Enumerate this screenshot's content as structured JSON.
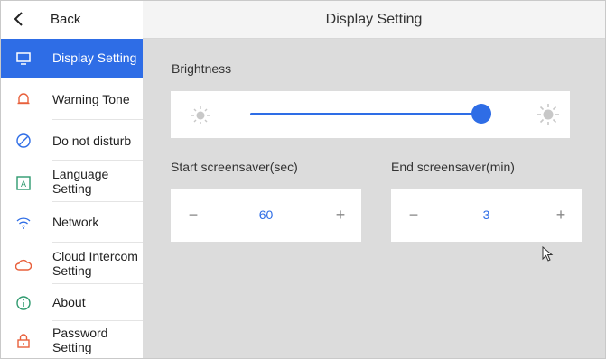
{
  "sidebar": {
    "back_label": "Back",
    "items": [
      {
        "label": "Display Setting",
        "icon": "monitor-icon",
        "active": true
      },
      {
        "label": "Warning Tone",
        "icon": "bell-icon"
      },
      {
        "label": "Do not disturb",
        "icon": "no-disturb-icon"
      },
      {
        "label_line1": "Language",
        "label_line2": "Setting",
        "icon": "language-icon"
      },
      {
        "label": "Network",
        "icon": "wifi-icon"
      },
      {
        "label_line1": "Cloud Intercom",
        "label_line2": "Setting",
        "icon": "cloud-icon"
      },
      {
        "label": "About",
        "icon": "info-icon"
      },
      {
        "label_line1": "Password",
        "label_line2": "Setting",
        "icon": "lock-icon"
      }
    ]
  },
  "header": {
    "title": "Display Setting"
  },
  "brightness": {
    "label": "Brightness",
    "level": 1.0
  },
  "screensaver_start": {
    "label": "Start screensaver(sec)",
    "minus": "−",
    "value": "60",
    "plus": "+"
  },
  "screensaver_end": {
    "label": "End screensaver(min)",
    "minus": "−",
    "value": "3",
    "plus": "+"
  },
  "colors": {
    "accent": "#2e6de6",
    "panel": "#dcdcdc",
    "icon_orange": "#e8603c"
  }
}
